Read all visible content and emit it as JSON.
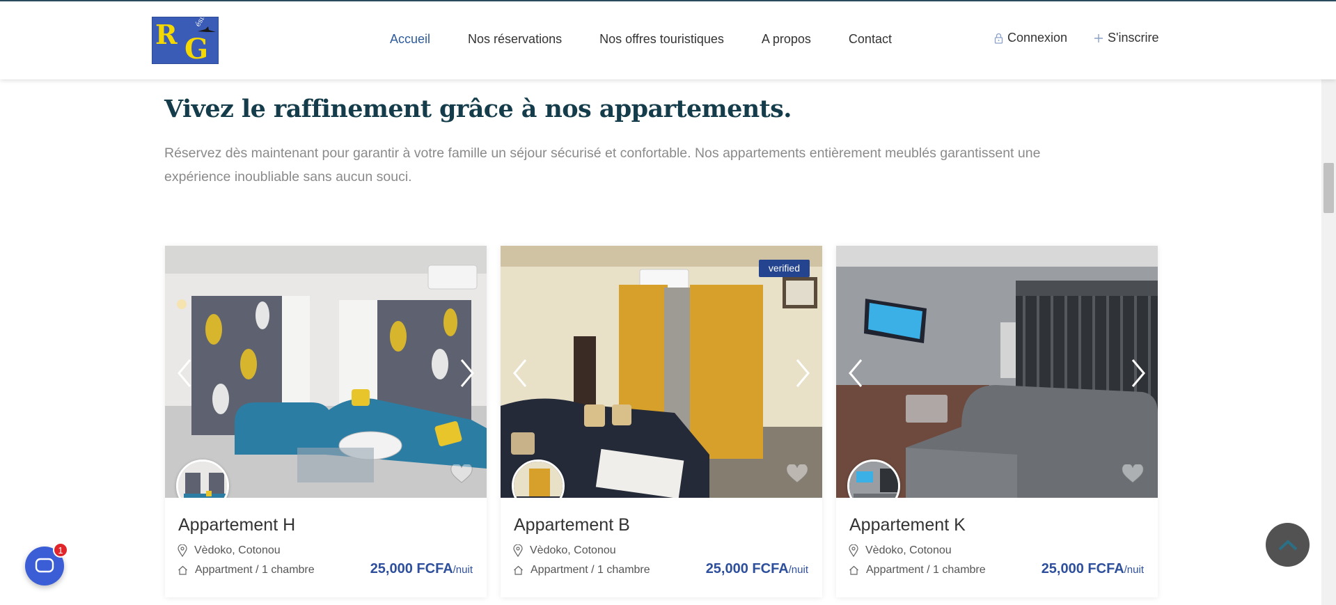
{
  "header": {
    "logo": {
      "text_r": "R",
      "text_g": "G",
      "text_small": "ésidences"
    },
    "nav": [
      {
        "label": "Accueil",
        "active": true
      },
      {
        "label": "Nos réservations",
        "active": false
      },
      {
        "label": "Nos offres touristiques",
        "active": false
      },
      {
        "label": "A propos",
        "active": false
      },
      {
        "label": "Contact",
        "active": false
      }
    ],
    "login_label": "Connexion",
    "signup_label": "S'inscrire",
    "login_icon": "lock-icon",
    "signup_icon": "plus-icon"
  },
  "intro": {
    "title": "Vivez le raffinement grâce à nos appartements.",
    "text": "Réservez dès maintenant pour garantir à votre famille un séjour sécurisé et confortable. Nos appartements entièrement meublés garantissent une expérience inoubliable sans aucun souci."
  },
  "listings": [
    {
      "title": "Appartement H",
      "location": "Vèdoko, Cotonou",
      "type": "Appartment / 1 chambre",
      "price": "25,000 FCFA",
      "unit": "/nuit",
      "badge": ""
    },
    {
      "title": "Appartement B",
      "location": "Vèdoko, Cotonou",
      "type": "Appartment / 1 chambre",
      "price": "25,000 FCFA",
      "unit": "/nuit",
      "badge": "verified"
    },
    {
      "title": "Appartement K",
      "location": "Vèdoko, Cotonou",
      "type": "Appartment / 1 chambre",
      "price": "25,000 FCFA",
      "unit": "/nuit",
      "badge": ""
    }
  ],
  "widgets": {
    "chat_count": "1"
  },
  "colors": {
    "accent": "#2d5a9c",
    "title": "#143c4a",
    "price": "#2d4f9c",
    "badge": "#24448f"
  }
}
